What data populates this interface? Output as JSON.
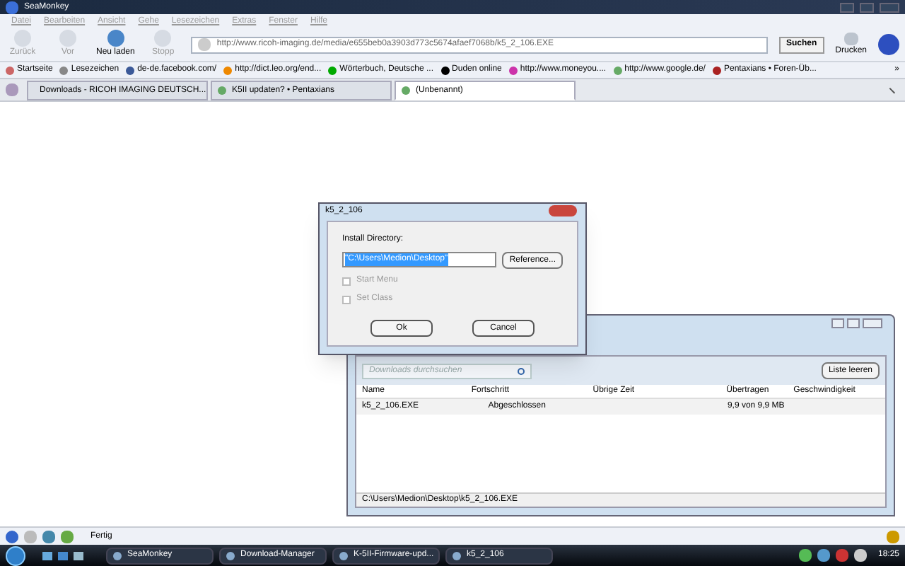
{
  "window": {
    "title": "SeaMonkey"
  },
  "menu": [
    "Datei",
    "Bearbeiten",
    "Ansicht",
    "Gehe",
    "Lesezeichen",
    "Extras",
    "Fenster",
    "Hilfe"
  ],
  "nav_buttons": [
    {
      "label": "Zurück",
      "disabled": true
    },
    {
      "label": "Vor",
      "disabled": true
    },
    {
      "label": "Neu laden",
      "disabled": false
    },
    {
      "label": "Stopp",
      "disabled": true
    }
  ],
  "url": "http://www.ricoh-imaging.de/media/e655beb0a3903d773c5674afaef7068b/k5_2_106.EXE",
  "search_button": "Suchen",
  "print_button": "Drucken",
  "bookmarks": [
    "Startseite",
    "Lesezeichen",
    "de-de.facebook.com/",
    "http://dict.leo.org/end...",
    "Wörterbuch, Deutsche ...",
    "Duden online",
    "http://www.moneyou....",
    "http://www.google.de/",
    "Pentaxians • Foren-Üb..."
  ],
  "bookmarks_more": "»",
  "tabs": [
    {
      "label": "Downloads - RICOH IMAGING DEUTSCH...",
      "selected": false
    },
    {
      "label": "K5II updaten? • Pentaxians",
      "selected": false
    },
    {
      "label": "(Unbenannt)",
      "selected": true
    }
  ],
  "dialog": {
    "title": "k5_2_106",
    "field_label": "Install Directory:",
    "directory": "\"C:\\Users\\Medion\\Desktop\"",
    "browse_button": "Reference...",
    "options": [
      {
        "label": "Start Menu",
        "checked": false,
        "disabled": true
      },
      {
        "label": "Set Class",
        "checked": false,
        "disabled": true
      }
    ],
    "buttons": [
      "Ok",
      "Cancel"
    ]
  },
  "downloads": {
    "search_placeholder": "Downloads durchsuchen",
    "clear_button": "Liste leeren",
    "columns": [
      "Name",
      "Fortschritt",
      "Übrige Zeit",
      "Übertragen",
      "Geschwindigkeit"
    ],
    "rows": [
      {
        "name": "k5_2_106.EXE",
        "progress": "Abgeschlossen",
        "remaining": "",
        "transferred": "9,9 von 9,9 MB",
        "speed": ""
      }
    ],
    "path": "C:\\Users\\Medion\\Desktop\\k5_2_106.EXE"
  },
  "status": "Fertig",
  "taskbar": [
    "SeaMonkey",
    "Download-Manager",
    "K-5II-Firmware-upd...",
    "k5_2_106"
  ],
  "clock": "18:25"
}
